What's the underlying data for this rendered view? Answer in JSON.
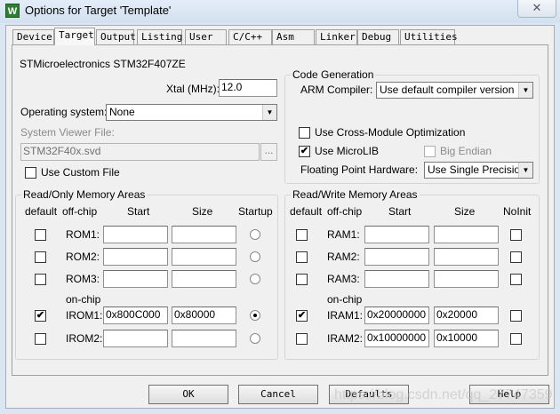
{
  "window": {
    "title": "Options for Target 'Template'",
    "close": "✕",
    "app_icon": "W"
  },
  "tabs": [
    "Device",
    "Target",
    "Output",
    "Listing",
    "User",
    "C/C++",
    "Asm",
    "Linker",
    "Debug",
    "Utilities"
  ],
  "active_tab": "Target",
  "device": "STMicroelectronics STM32F407ZE",
  "xtal": {
    "label": "Xtal (MHz):",
    "value": "12.0"
  },
  "os": {
    "label": "Operating system:",
    "value": "None"
  },
  "svf": {
    "label": "System Viewer File:",
    "value": "STM32F40x.svd",
    "browse": "...",
    "custom_label": "Use Custom File",
    "custom_checked": false
  },
  "codegen": {
    "title": "Code Generation",
    "compiler_label": "ARM Compiler:",
    "compiler_value": "Use default compiler version",
    "cross_module": "Use Cross-Module Optimization",
    "cross_checked": false,
    "microlib": "Use MicroLIB",
    "microlib_checked": true,
    "big_endian": "Big Endian",
    "fp_label": "Floating Point Hardware:",
    "fp_value": "Use Single Precision"
  },
  "rom": {
    "title": "Read/Only Memory Areas",
    "headers": {
      "default": "default",
      "offchip": "off-chip",
      "start": "Start",
      "size": "Size",
      "extra": "Startup"
    },
    "onchip": "on-chip",
    "rows": [
      {
        "name": "ROM1:",
        "start": "",
        "size": "",
        "default": false,
        "startup": false
      },
      {
        "name": "ROM2:",
        "start": "",
        "size": "",
        "default": false,
        "startup": false
      },
      {
        "name": "ROM3:",
        "start": "",
        "size": "",
        "default": false,
        "startup": false
      },
      {
        "name": "IROM1:",
        "start": "0x800C000",
        "size": "0x80000",
        "default": true,
        "startup": true
      },
      {
        "name": "IROM2:",
        "start": "",
        "size": "",
        "default": false,
        "startup": false
      }
    ]
  },
  "ram": {
    "title": "Read/Write Memory Areas",
    "headers": {
      "default": "default",
      "offchip": "off-chip",
      "start": "Start",
      "size": "Size",
      "extra": "NoInit"
    },
    "onchip": "on-chip",
    "rows": [
      {
        "name": "RAM1:",
        "start": "",
        "size": "",
        "default": false,
        "noinit": false
      },
      {
        "name": "RAM2:",
        "start": "",
        "size": "",
        "default": false,
        "noinit": false
      },
      {
        "name": "RAM3:",
        "start": "",
        "size": "",
        "default": false,
        "noinit": false
      },
      {
        "name": "IRAM1:",
        "start": "0x20000000",
        "size": "0x20000",
        "default": true,
        "noinit": false
      },
      {
        "name": "IRAM2:",
        "start": "0x10000000",
        "size": "0x10000",
        "default": false,
        "noinit": false
      }
    ]
  },
  "buttons": {
    "ok": "OK",
    "cancel": "Cancel",
    "defaults": "Defaults",
    "help": "Help"
  },
  "watermark": "https://blog.csdn.net/qq_27747359"
}
